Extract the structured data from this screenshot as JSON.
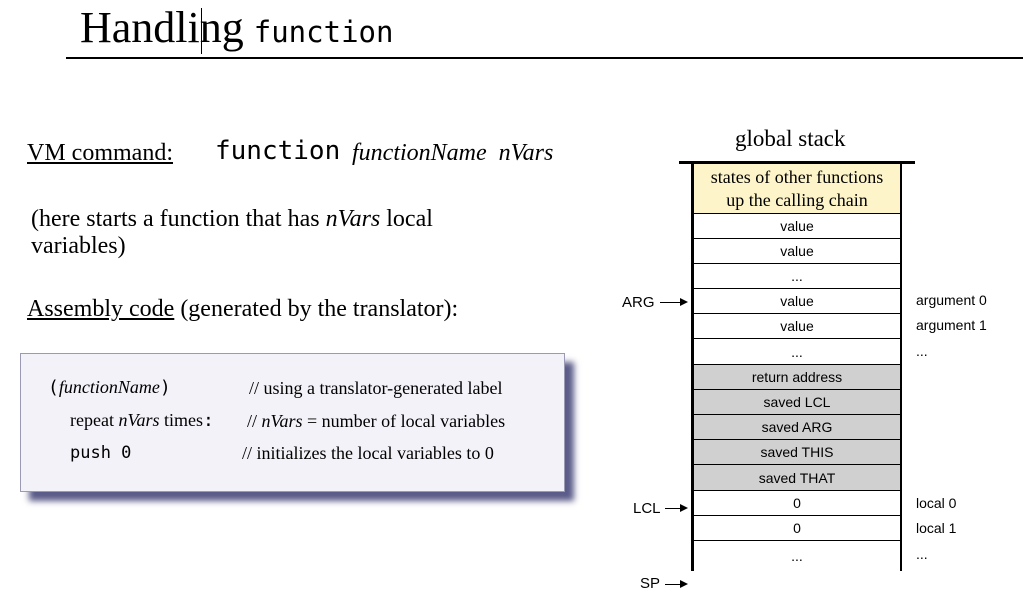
{
  "title": {
    "main": "Handling",
    "code": "function"
  },
  "vm": {
    "label": "VM command:",
    "code": "function",
    "arg1": "functionName",
    "arg2": "nVars"
  },
  "description": {
    "prefix": "(here starts a function that has ",
    "var": "nVars",
    "suffix": " local variables)"
  },
  "assembly": {
    "label": "Assembly code",
    "suffix": " (generated by the translator):"
  },
  "code_box": {
    "line1": {
      "open": "(",
      "name": "functionName",
      "close": ")",
      "comment": "// using a translator-generated label"
    },
    "line2": {
      "prefix": "repeat ",
      "var": "nVars",
      "suffix": " times",
      "colon": ":",
      "comment_slashes": "// ",
      "comment_var": "nVars",
      "comment_rest": " = number of local variables"
    },
    "line3": {
      "code": "push 0",
      "comment": "// initializes the local variables to 0"
    }
  },
  "stack": {
    "title": "global stack",
    "head_line1": "states of other functions",
    "head_line2": "up the calling chain",
    "cells": [
      "value",
      "value",
      "...",
      "value",
      "value",
      "...",
      "return address",
      "saved LCL",
      "saved ARG",
      "saved THIS",
      "saved THAT",
      "0",
      "0",
      "..."
    ],
    "side_labels": [
      "argument 0",
      "argument 1",
      "...",
      "local 0",
      "local 1",
      "..."
    ],
    "pointers": {
      "arg": "ARG",
      "lcl": "LCL",
      "sp": "SP"
    }
  }
}
